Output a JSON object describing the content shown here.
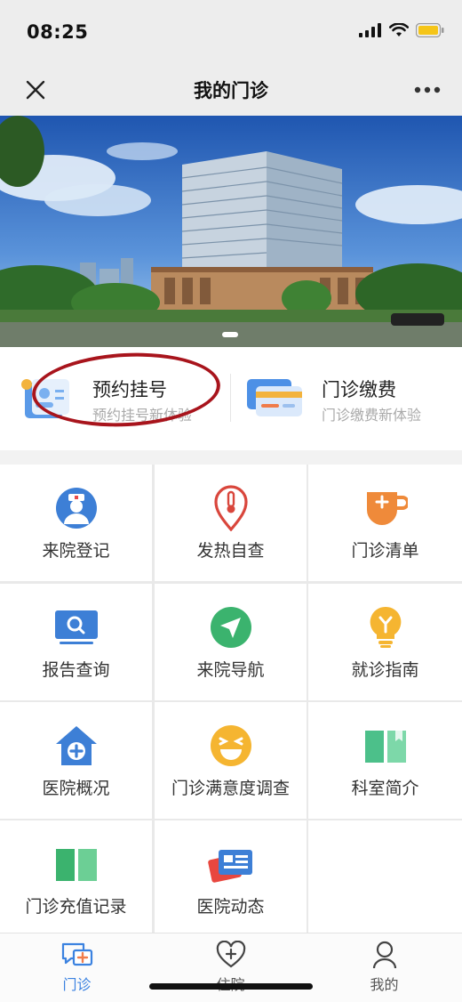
{
  "status_bar": {
    "time": "08:25"
  },
  "nav": {
    "title": "我的门诊"
  },
  "quick_actions": [
    {
      "title": "预约挂号",
      "subtitle": "预约挂号新体验"
    },
    {
      "title": "门诊缴费",
      "subtitle": "门诊缴费新体验"
    }
  ],
  "grid": [
    {
      "label": "来院登记",
      "icon": "nurse-icon"
    },
    {
      "label": "发热自查",
      "icon": "thermometer-pin-icon"
    },
    {
      "label": "门诊清单",
      "icon": "cup-plus-icon"
    },
    {
      "label": "报告查询",
      "icon": "monitor-search-icon"
    },
    {
      "label": "来院导航",
      "icon": "navigation-arrow-icon"
    },
    {
      "label": "就诊指南",
      "icon": "lightbulb-icon"
    },
    {
      "label": "医院概况",
      "icon": "hospital-house-icon"
    },
    {
      "label": "门诊满意度调查",
      "icon": "smiley-face-icon"
    },
    {
      "label": "科室简介",
      "icon": "open-book-icon"
    },
    {
      "label": "门诊充值记录",
      "icon": "green-book-icon"
    },
    {
      "label": "医院动态",
      "icon": "newspaper-icon"
    }
  ],
  "tabs": [
    {
      "label": "门诊",
      "icon": "outpatient-chat-icon",
      "active": true
    },
    {
      "label": "住院",
      "icon": "heart-plus-icon",
      "active": false
    },
    {
      "label": "我的",
      "icon": "person-icon",
      "active": false
    }
  ],
  "colors": {
    "accent": "#3b82e0",
    "highlight": "#a8141c",
    "nav_bg": "#ededed"
  }
}
